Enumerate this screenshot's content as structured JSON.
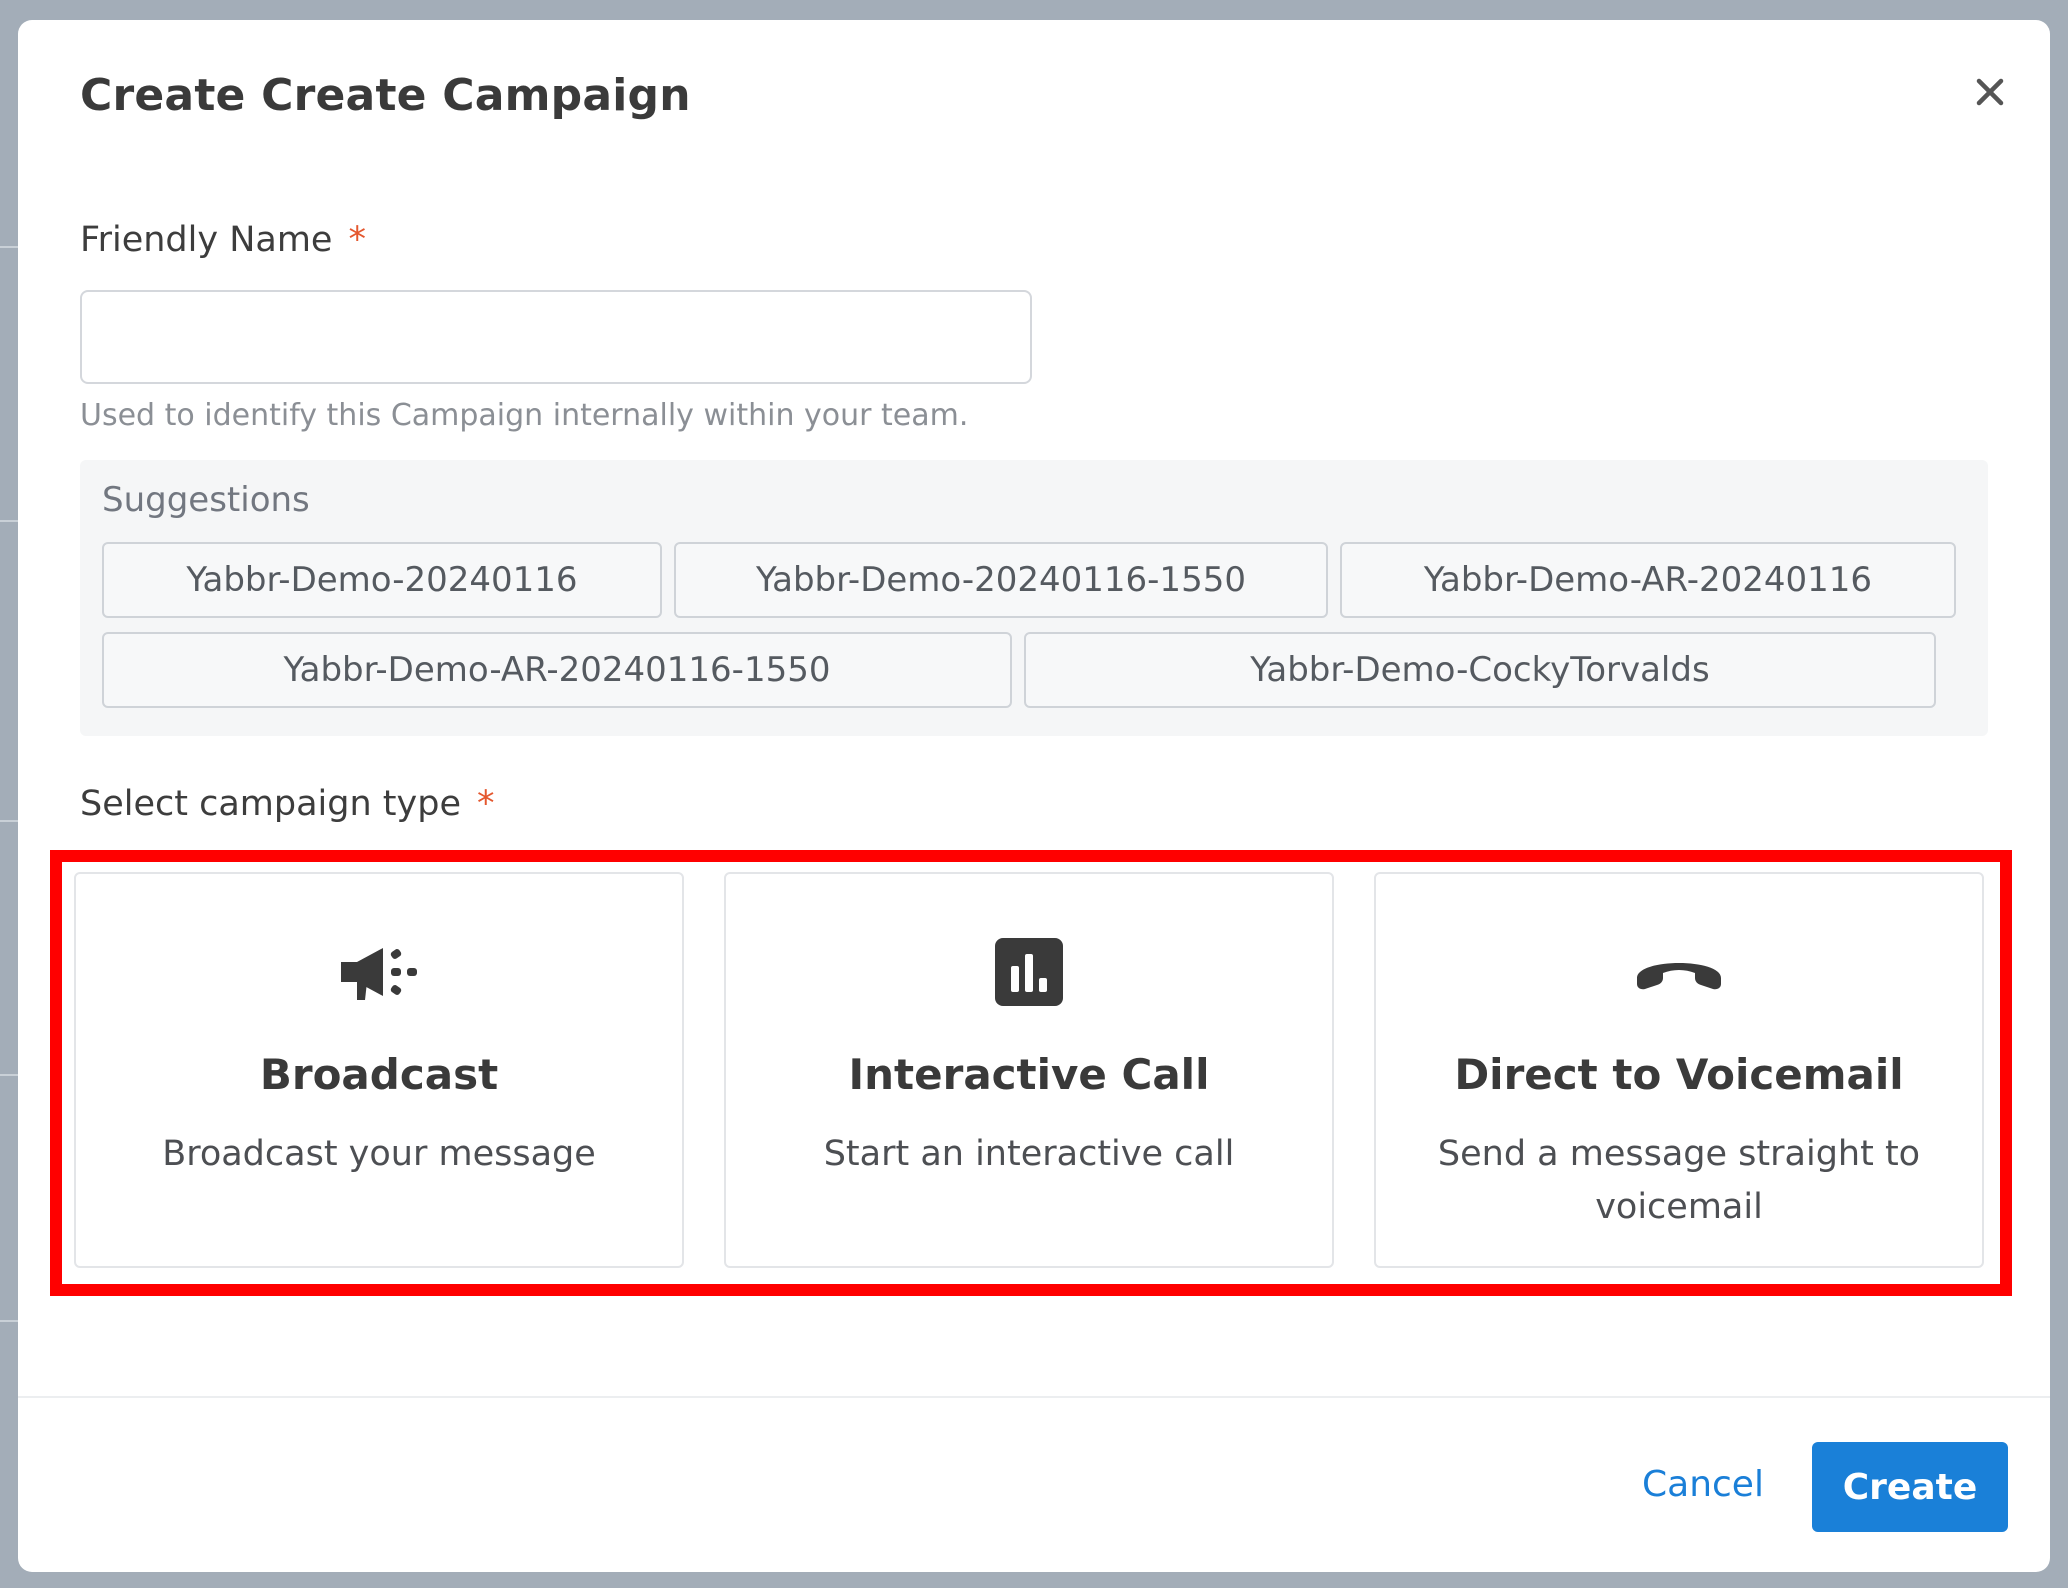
{
  "modal": {
    "title": "Create Create Campaign",
    "close_icon": "close-icon"
  },
  "friendly_name": {
    "label": "Friendly Name",
    "required_marker": "*",
    "value": "",
    "placeholder": "",
    "help_text": "Used to identify this Campaign internally within your team."
  },
  "suggestions": {
    "title": "Suggestions",
    "items": [
      "Yabbr-Demo-20240116",
      "Yabbr-Demo-20240116-1550",
      "Yabbr-Demo-AR-20240116",
      "Yabbr-Demo-AR-20240116-1550",
      "Yabbr-Demo-CockyTorvalds"
    ]
  },
  "campaign_type": {
    "label": "Select campaign type",
    "required_marker": "*",
    "options": [
      {
        "icon": "megaphone-icon",
        "title": "Broadcast",
        "description": "Broadcast your message"
      },
      {
        "icon": "bar-chart-icon",
        "title": "Interactive Call",
        "description": "Start an interactive call"
      },
      {
        "icon": "phone-hangup-icon",
        "title": "Direct to Voicemail",
        "description": "Send a message straight to voicemail"
      }
    ]
  },
  "footer": {
    "cancel_label": "Cancel",
    "create_label": "Create"
  },
  "colors": {
    "accent": "#1a80d8",
    "required": "#e4572e",
    "highlight": "#ff0000"
  }
}
